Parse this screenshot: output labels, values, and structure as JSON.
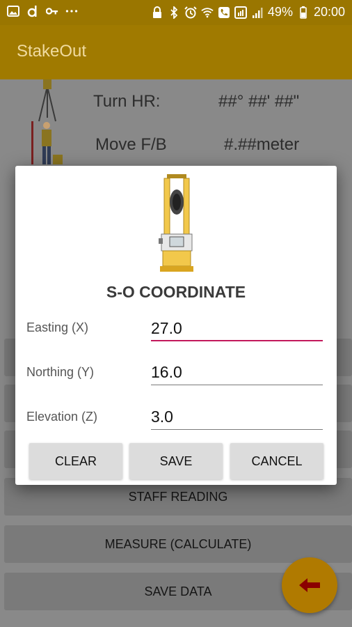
{
  "status_bar": {
    "battery": "49%",
    "time": "20:00",
    "left_icons": [
      "image-icon",
      "d-icon",
      "key-icon",
      "more-icon"
    ],
    "right_icons": [
      "lock-icon",
      "bluetooth-icon",
      "alarm-icon",
      "wifi-icon",
      "call-icon",
      "sim-icon",
      "signal-icon",
      "battery-icon"
    ]
  },
  "app_bar": {
    "title": "StakeOut"
  },
  "main": {
    "turn_hr": {
      "label": "Turn HR:",
      "value": "##° ##' ##\""
    },
    "move_fb": {
      "label": "Move F/B",
      "value": "#.##meter"
    },
    "buttons": [
      "STAFF READING",
      "MEASURE (CALCULATE)",
      "SAVE DATA"
    ]
  },
  "dialog": {
    "title": "S-O COORDINATE",
    "fields": [
      {
        "label": "Easting (X)",
        "value": "27.0"
      },
      {
        "label": "Northing (Y)",
        "value": "16.0"
      },
      {
        "label": "Elevation (Z)",
        "value": "3.0"
      }
    ],
    "buttons": [
      "CLEAR",
      "SAVE",
      "CANCEL"
    ]
  },
  "colors": {
    "app_bar": "#a07a00",
    "accent_underline": "#c2185b",
    "fab": "#b07a00",
    "fab_arrow": "#8b0000"
  }
}
